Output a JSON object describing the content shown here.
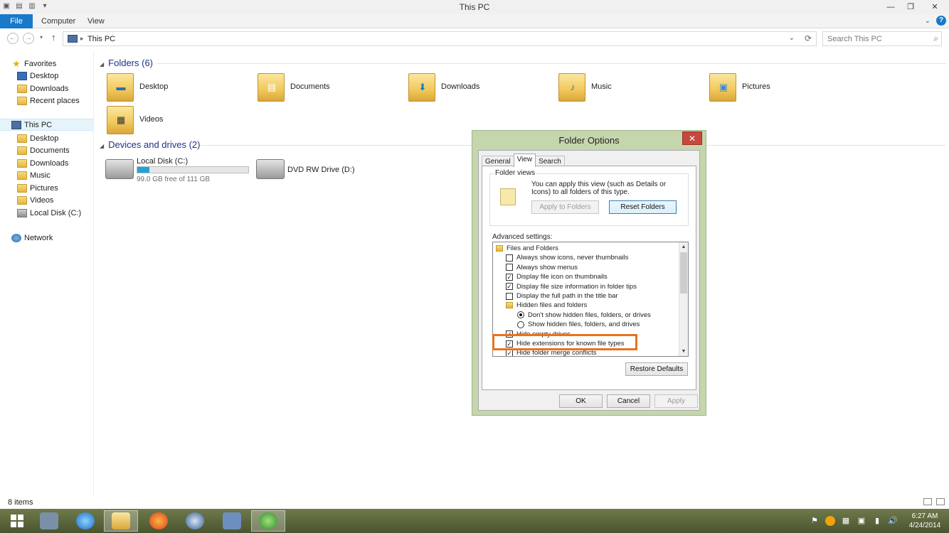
{
  "window": {
    "title": "This PC",
    "ribbon_tabs": [
      "File",
      "Computer",
      "View"
    ],
    "help_glyph": "?"
  },
  "address": {
    "crumb": "This PC",
    "search_placeholder": "Search This PC"
  },
  "nav": {
    "favorites": "Favorites",
    "fav_items": [
      "Desktop",
      "Downloads",
      "Recent places"
    ],
    "this_pc": "This PC",
    "pc_items": [
      "Desktop",
      "Documents",
      "Downloads",
      "Music",
      "Pictures",
      "Videos",
      "Local Disk (C:)"
    ],
    "network": "Network"
  },
  "content": {
    "folders_header": "Folders (6)",
    "folders": [
      "Desktop",
      "Documents",
      "Downloads",
      "Music",
      "Pictures",
      "Videos"
    ],
    "devices_header": "Devices and drives (2)",
    "drive_c_name": "Local Disk (C:)",
    "drive_c_free": "99.0 GB free of 111 GB",
    "drive_c_used_fraction": 0.11,
    "drive_d_name": "DVD RW Drive (D:)"
  },
  "status": {
    "items": "8 items"
  },
  "taskbar": {
    "time": "6:27 AM",
    "date": "4/24/2014"
  },
  "dialog": {
    "title": "Folder Options",
    "close": "✕",
    "tabs": [
      "General",
      "View",
      "Search"
    ],
    "folder_views_legend": "Folder views",
    "folder_views_text": "You can apply this view (such as Details or Icons) to all folders of this type.",
    "apply_to_folders": "Apply to Folders",
    "reset_folders": "Reset Folders",
    "advanced_label": "Advanced settings:",
    "tree": [
      {
        "kind": "folder",
        "label": "Files and Folders"
      },
      {
        "kind": "check",
        "checked": false,
        "label": "Always show icons, never thumbnails"
      },
      {
        "kind": "check",
        "checked": false,
        "label": "Always show menus"
      },
      {
        "kind": "check",
        "checked": true,
        "label": "Display file icon on thumbnails"
      },
      {
        "kind": "check",
        "checked": true,
        "label": "Display file size information in folder tips"
      },
      {
        "kind": "check",
        "checked": false,
        "label": "Display the full path in the title bar"
      },
      {
        "kind": "folder",
        "label": "Hidden files and folders"
      },
      {
        "kind": "radio",
        "checked": true,
        "label": "Don't show hidden files, folders, or drives"
      },
      {
        "kind": "radio",
        "checked": false,
        "label": "Show hidden files, folders, and drives"
      },
      {
        "kind": "check",
        "checked": true,
        "label": "Hide empty drives"
      },
      {
        "kind": "check",
        "checked": true,
        "label": "Hide extensions for known file types"
      },
      {
        "kind": "check",
        "checked": true,
        "label": "Hide folder merge conflicts"
      }
    ],
    "restore_defaults": "Restore Defaults",
    "ok": "OK",
    "cancel": "Cancel",
    "apply": "Apply"
  }
}
